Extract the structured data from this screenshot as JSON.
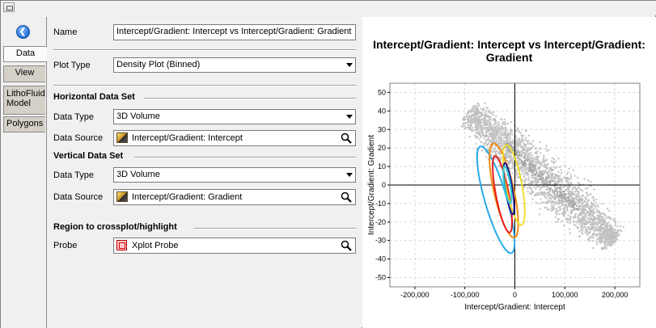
{
  "tabs": [
    {
      "label": "Data",
      "active": true
    },
    {
      "label": "View",
      "active": false
    },
    {
      "label": "LithoFluid\nModel",
      "active": false
    },
    {
      "label": "Polygons",
      "active": false
    }
  ],
  "form": {
    "name_label": "Name",
    "name_value": "Intercept/Gradient: Intercept vs Intercept/Gradient: Gradient",
    "plot_type_label": "Plot Type",
    "plot_type_value": "Density Plot (Binned)",
    "horizontal": {
      "title": "Horizontal Data Set",
      "data_type_label": "Data Type",
      "data_type_value": "3D Volume",
      "data_source_label": "Data Source",
      "data_source_value": "Intercept/Gradient: Intercept"
    },
    "vertical": {
      "title": "Vertical Data Set",
      "data_type_label": "Data Type",
      "data_type_value": "3D Volume",
      "data_source_label": "Data Source",
      "data_source_value": "Intercept/Gradient: Gradient"
    },
    "region": {
      "title": "Region to crossplot/highlight",
      "probe_label": "Probe",
      "probe_value": "Xplot Probe"
    }
  },
  "chart_data": {
    "type": "scatter",
    "title_line1": "Intercept/Gradient: Intercept vs Intercept/Gradient:",
    "title_line2": "Gradient",
    "xlabel": "Intercept/Gradient: Intercept",
    "ylabel": "Intercept/Gradient: Gradient",
    "xlim": [
      -250000,
      250000
    ],
    "ylim": [
      -55,
      55
    ],
    "xticks": [
      -200000,
      -100000,
      0,
      100000,
      200000
    ],
    "xtick_labels": [
      "-200,000",
      "-100,000",
      "0",
      "100,000",
      "200,000"
    ],
    "yticks": [
      50,
      40,
      30,
      20,
      10,
      0,
      -10,
      -20,
      -30,
      -40,
      -50
    ],
    "grid": true,
    "density_cloud": {
      "color": "#c0c0c0",
      "dense_color": "#a8a8a8",
      "axis_start": [
        -95000,
        40
      ],
      "axis_end": [
        200000,
        -30
      ],
      "half_width": 8
    },
    "ellipses": [
      {
        "color": "#29a8e8",
        "cx": -38000,
        "cy": -8,
        "rx": 22000,
        "ry": 30,
        "tilt": -0.9
      },
      {
        "color": "#f08a10",
        "cx": -22000,
        "cy": -3,
        "rx": 20000,
        "ry": 26,
        "tilt": -0.7
      },
      {
        "color": "#e81c1c",
        "cx": -25000,
        "cy": -5,
        "rx": 13000,
        "ry": 21,
        "tilt": -0.6
      },
      {
        "color": "#f0e030",
        "cx": -2000,
        "cy": 0,
        "rx": 16000,
        "ry": 22,
        "tilt": -0.6
      },
      {
        "color": "#1a1a9a",
        "cx": -12000,
        "cy": -2,
        "rx": 7000,
        "ry": 14,
        "tilt": -0.5
      },
      {
        "color": "#30d0d0",
        "cx": -15000,
        "cy": 0,
        "rx": 6000,
        "ry": 10,
        "tilt": -0.5
      }
    ]
  }
}
